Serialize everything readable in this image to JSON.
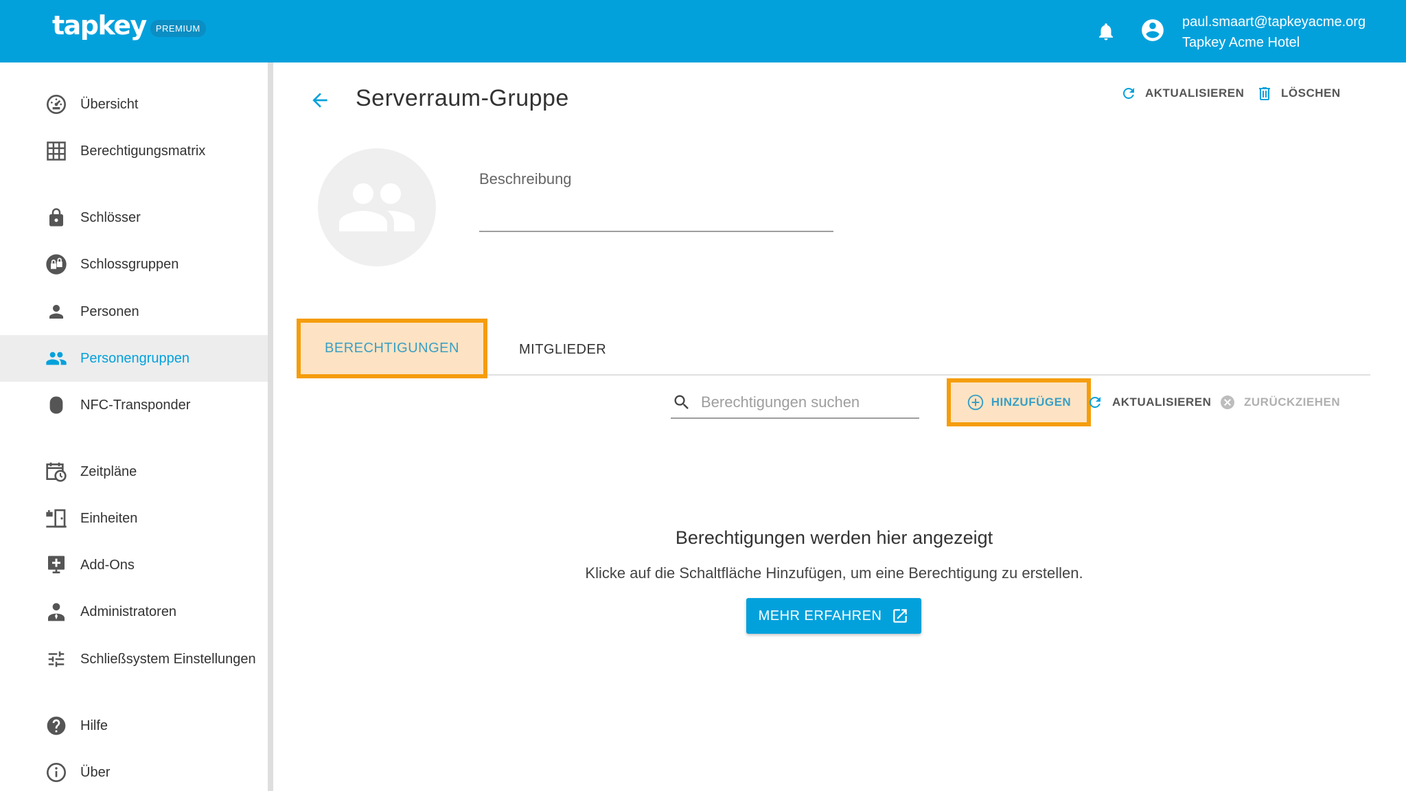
{
  "header": {
    "logo_text": "tapkey",
    "logo_badge": "PREMIUM",
    "user_email": "paul.smaart@tapkeyacme.org",
    "user_org": "Tapkey Acme Hotel"
  },
  "sidebar": {
    "items": [
      {
        "label": "Übersicht",
        "icon": "dashboard-icon"
      },
      {
        "label": "Berechtigungsmatrix",
        "icon": "grid-icon"
      },
      {
        "label": "Schlösser",
        "icon": "lock-icon"
      },
      {
        "label": "Schlossgruppen",
        "icon": "lock-group-icon"
      },
      {
        "label": "Personen",
        "icon": "person-icon"
      },
      {
        "label": "Personengruppen",
        "icon": "people-icon",
        "active": true
      },
      {
        "label": "NFC-Transponder",
        "icon": "nfc-icon"
      },
      {
        "label": "Zeitpläne",
        "icon": "schedule-icon"
      },
      {
        "label": "Einheiten",
        "icon": "units-icon"
      },
      {
        "label": "Add-Ons",
        "icon": "addons-icon"
      },
      {
        "label": "Administratoren",
        "icon": "admin-icon"
      },
      {
        "label": "Schließsystem Einstellungen",
        "icon": "settings-sliders-icon"
      },
      {
        "label": "Hilfe",
        "icon": "help-icon"
      },
      {
        "label": "Über",
        "icon": "info-icon"
      }
    ]
  },
  "main": {
    "title": "Serverraum-Gruppe",
    "refresh_label": "AKTUALISIEREN",
    "delete_label": "LÖSCHEN",
    "description_label": "Beschreibung",
    "tabs": [
      {
        "label": "BERECHTIGUNGEN",
        "active": true
      },
      {
        "label": "MITGLIEDER",
        "active": false
      }
    ],
    "search": {
      "placeholder": "Berechtigungen suchen",
      "value": ""
    },
    "add_label": "HINZUFÜGEN",
    "toolbar_refresh_label": "AKTUALISIEREN",
    "revoke_label": "ZURÜCKZIEHEN",
    "empty_title": "Berechtigungen werden hier angezeigt",
    "empty_text": "Klicke auf die Schaltfläche Hinzufügen, um eine Berechtigung zu erstellen.",
    "learn_more_label": "MEHR ERFAHREN"
  },
  "colors": {
    "brand": "#03a1dc",
    "highlight_border": "#f59d0a",
    "highlight_fill": "#fde3c3"
  }
}
